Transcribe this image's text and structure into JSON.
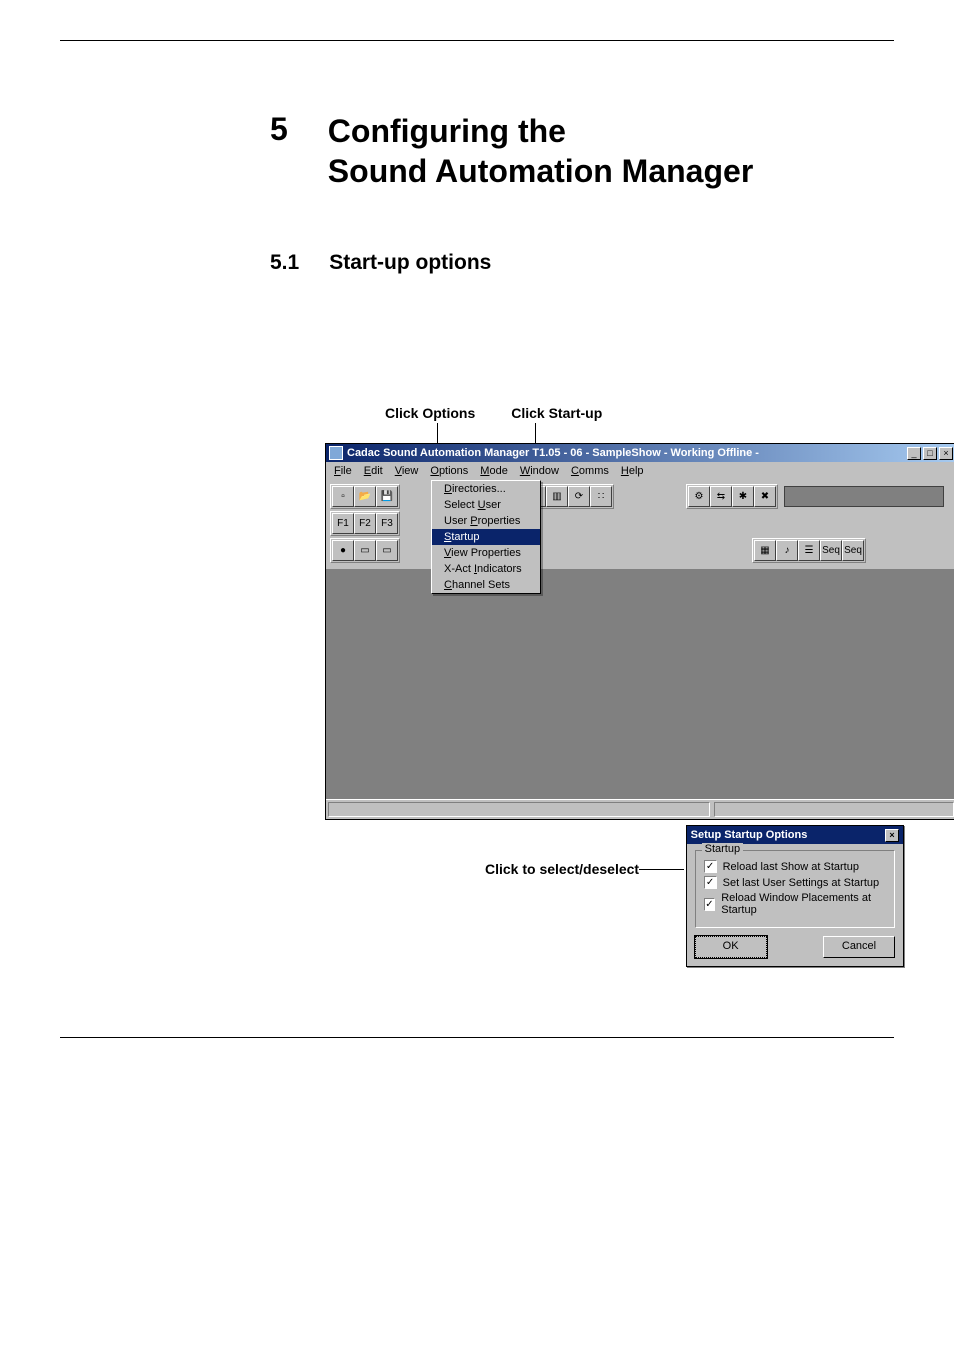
{
  "chapter": {
    "num": "5",
    "title_line1": "Configuring the",
    "title_line2": "Sound Automation Manager"
  },
  "section": {
    "num": "5.1",
    "title": "Start-up options"
  },
  "callouts": {
    "options": "Click Options",
    "startup": "Click Start-up",
    "select": "Click to select/deselect"
  },
  "app": {
    "title": "Cadac Sound Automation Manager T1.05 - 06 - SampleShow    - Working Offline -",
    "menus": {
      "file": "File",
      "file_u": "F",
      "edit": "Edit",
      "edit_u": "E",
      "view": "View",
      "view_u": "V",
      "options": "Options",
      "options_u": "O",
      "mode": "Mode",
      "mode_u": "M",
      "window": "Window",
      "window_u": "W",
      "comms": "Comms",
      "comms_u": "C",
      "help": "Help",
      "help_u": "H"
    },
    "options_menu": {
      "directories": "Directories...",
      "select_user": "Select User",
      "user_properties": "User Properties",
      "startup": "Startup",
      "view_properties": "View Properties",
      "xact_indicators": "X-Act Indicators",
      "channel_sets": "Channel Sets"
    }
  },
  "dialog": {
    "title": "Setup Startup Options",
    "group": "Startup",
    "opt1": "Reload last Show at Startup",
    "opt2": "Set last User Settings at Startup",
    "opt3": "Reload Window Placements at Startup",
    "ok": "OK",
    "cancel": "Cancel"
  }
}
